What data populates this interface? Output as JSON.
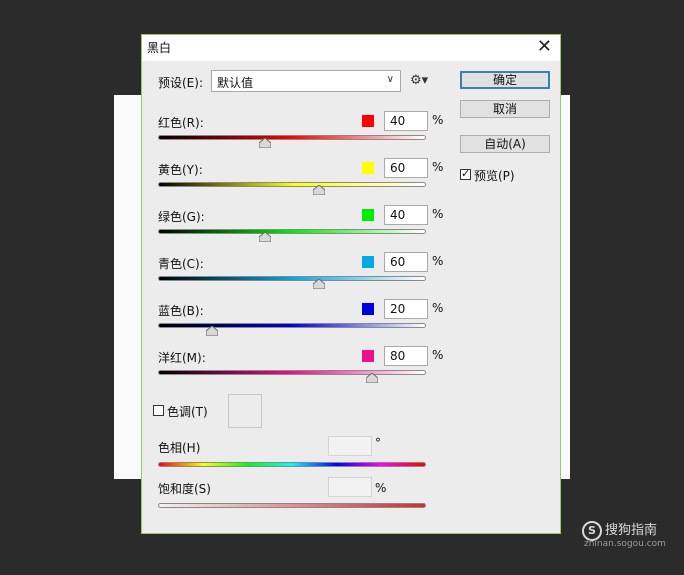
{
  "dialog": {
    "title": "黑白",
    "preset_label": "预设(E):",
    "preset_value": "默认值",
    "buttons": {
      "ok": "确定",
      "cancel": "取消",
      "auto": "自动(A)"
    },
    "preview_label": "预览(P)",
    "preview_checked": true,
    "channels": [
      {
        "label": "红色(R):",
        "value": "40",
        "percent": 0.4,
        "color": "#ff0000"
      },
      {
        "label": "黄色(Y):",
        "value": "60",
        "percent": 0.6,
        "color": "#ffff00"
      },
      {
        "label": "绿色(G):",
        "value": "40",
        "percent": 0.4,
        "color": "#00ee00"
      },
      {
        "label": "青色(C):",
        "value": "60",
        "percent": 0.6,
        "color": "#00a8e8"
      },
      {
        "label": "蓝色(B):",
        "value": "20",
        "percent": 0.2,
        "color": "#0000dd"
      },
      {
        "label": "洋红(M):",
        "value": "80",
        "percent": 0.8,
        "color": "#ee0f8a"
      }
    ],
    "percent_sign": "%",
    "tint_label": "色调(T)",
    "tint_checked": false,
    "hue_label": "色相(H)",
    "hue_unit": "°",
    "saturation_label": "饱和度(S)",
    "saturation_unit": "%"
  },
  "watermark": {
    "logo": "S",
    "text": "搜狗指南",
    "url": "zhinan.sogou.com"
  }
}
